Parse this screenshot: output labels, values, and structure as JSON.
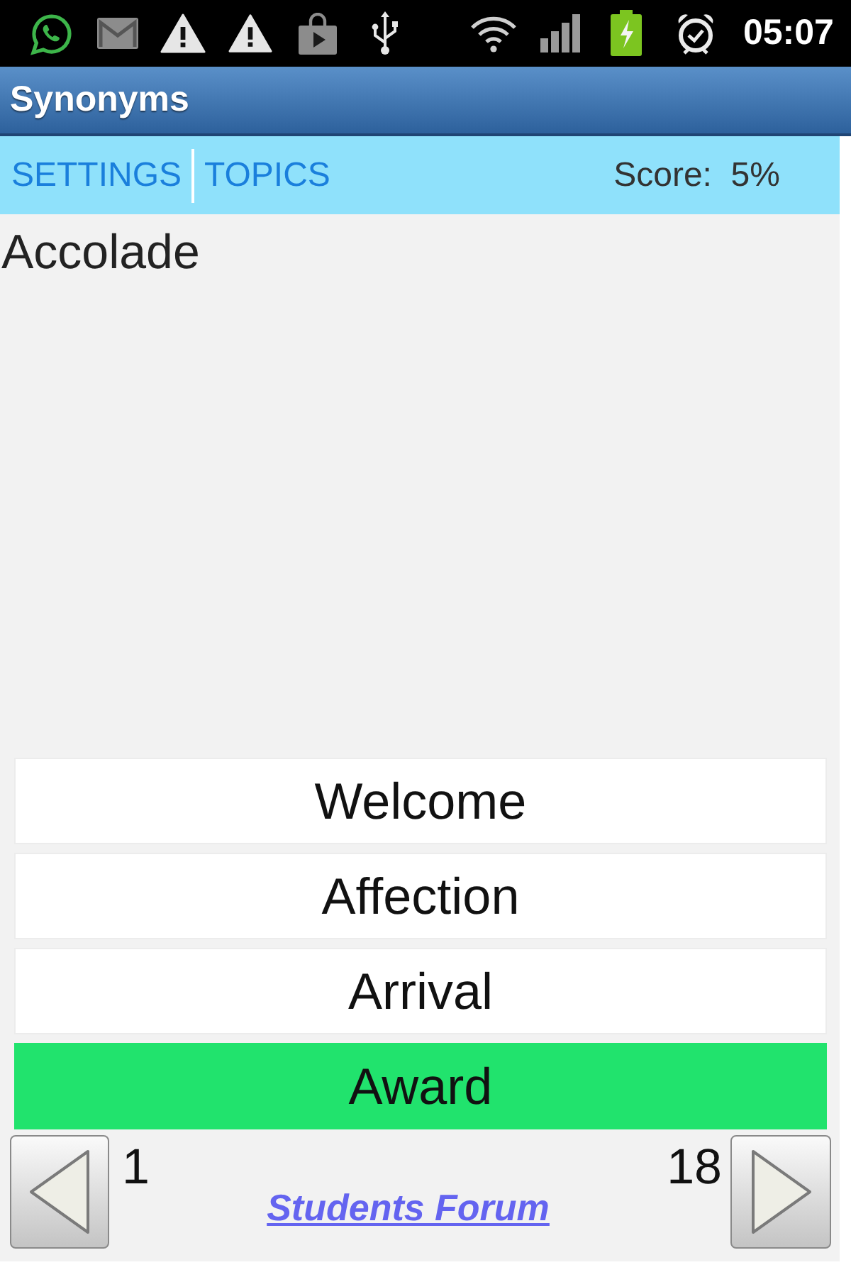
{
  "status_bar": {
    "time": "05:07"
  },
  "title_bar": {
    "title": "Synonyms"
  },
  "toolbar": {
    "links": [
      {
        "label": "SETTINGS"
      },
      {
        "label": "TOPICS"
      }
    ],
    "score": "Score:  5%"
  },
  "question": {
    "word": "Accolade"
  },
  "options": [
    {
      "label": "Welcome",
      "selected": false
    },
    {
      "label": "Affection",
      "selected": false
    },
    {
      "label": "Arrival",
      "selected": false
    },
    {
      "label": "Award",
      "selected": true
    }
  ],
  "footer": {
    "left_number": "1",
    "right_number": "18",
    "link": "Students Forum"
  }
}
